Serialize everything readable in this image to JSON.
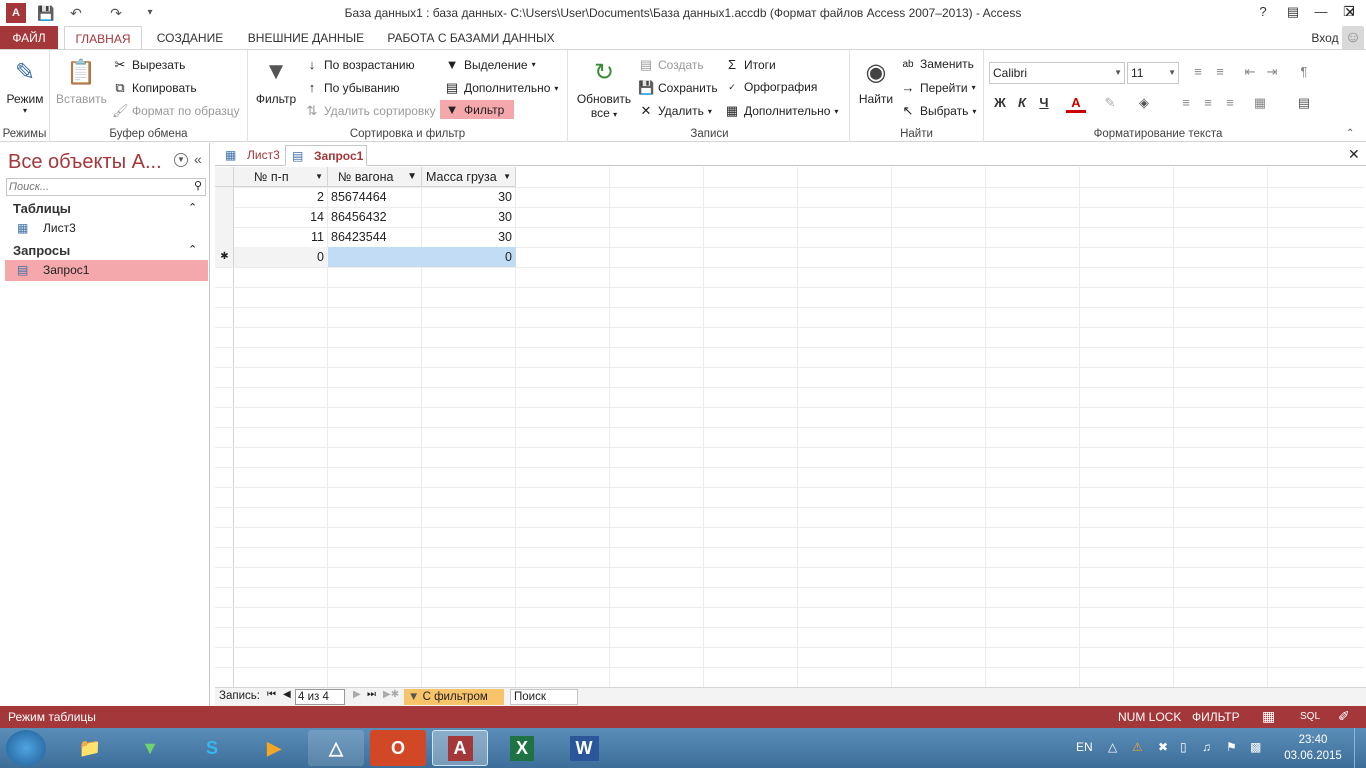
{
  "window": {
    "title": "База данных1 : база данных- C:\\Users\\User\\Documents\\База данных1.accdb (Формат файлов Access 2007–2013) - Access",
    "help": "?",
    "signin": "Вход"
  },
  "tabs": {
    "file": "ФАЙЛ",
    "home": "ГЛАВНАЯ",
    "create": "СОЗДАНИЕ",
    "external": "ВНЕШНИЕ ДАННЫЕ",
    "dbtools": "РАБОТА С БАЗАМИ ДАННЫХ"
  },
  "ribbon": {
    "views": {
      "mode": "Режим",
      "label": "Режимы"
    },
    "clipboard": {
      "paste": "Вставить",
      "cut": "Вырезать",
      "copy": "Копировать",
      "format": "Формат по образцу",
      "label": "Буфер обмена"
    },
    "sort": {
      "filter": "Фильтр",
      "asc": "По возрастанию",
      "desc": "По убыванию",
      "remove": "Удалить сортировку",
      "selection": "Выделение",
      "advanced": "Дополнительно",
      "toggle": "Фильтр",
      "label": "Сортировка и фильтр"
    },
    "records": {
      "refresh1": "Обновить",
      "refresh2": "все",
      "new": "Создать",
      "save": "Сохранить",
      "delete": "Удалить",
      "totals": "Итоги",
      "spelling": "Орфография",
      "more": "Дополнительно",
      "label": "Записи"
    },
    "find": {
      "find": "Найти",
      "replace": "Заменить",
      "goto": "Перейти",
      "select": "Выбрать",
      "label": "Найти"
    },
    "text": {
      "font": "Calibri",
      "size": "11",
      "bold": "Ж",
      "italic": "К",
      "underline": "Ч",
      "label": "Форматирование текста"
    }
  },
  "nav": {
    "title": "Все объекты A...",
    "search_placeholder": "Поиск...",
    "tables_header": "Таблицы",
    "tables": [
      "Лист3"
    ],
    "queries_header": "Запросы",
    "queries": [
      "Запрос1"
    ]
  },
  "doc": {
    "tabs": [
      "Лист3",
      "Запрос1"
    ],
    "columns": [
      "№ п-п",
      "№ вагона",
      "Масса груза"
    ],
    "rows": [
      [
        "2",
        "85674464",
        "30"
      ],
      [
        "14",
        "86456432",
        "30"
      ],
      [
        "11",
        "86423544",
        "30"
      ]
    ],
    "new_row": [
      "0",
      "",
      "0"
    ],
    "new_marker": "✱"
  },
  "recnav": {
    "label": "Запись:",
    "position": "4 из 4",
    "filter": "С фильтром",
    "search": "Поиск"
  },
  "status": {
    "mode": "Режим таблицы",
    "numlock": "NUM LOCK",
    "filter": "ФИЛЬТР",
    "sql": "SQL"
  },
  "taskbar": {
    "lang": "EN",
    "time": "23:40",
    "date": "03.06.2015"
  },
  "colors": {
    "accent": "#a4373a",
    "selected": "#f4a8ab",
    "newrow": "#c3dcf5"
  }
}
